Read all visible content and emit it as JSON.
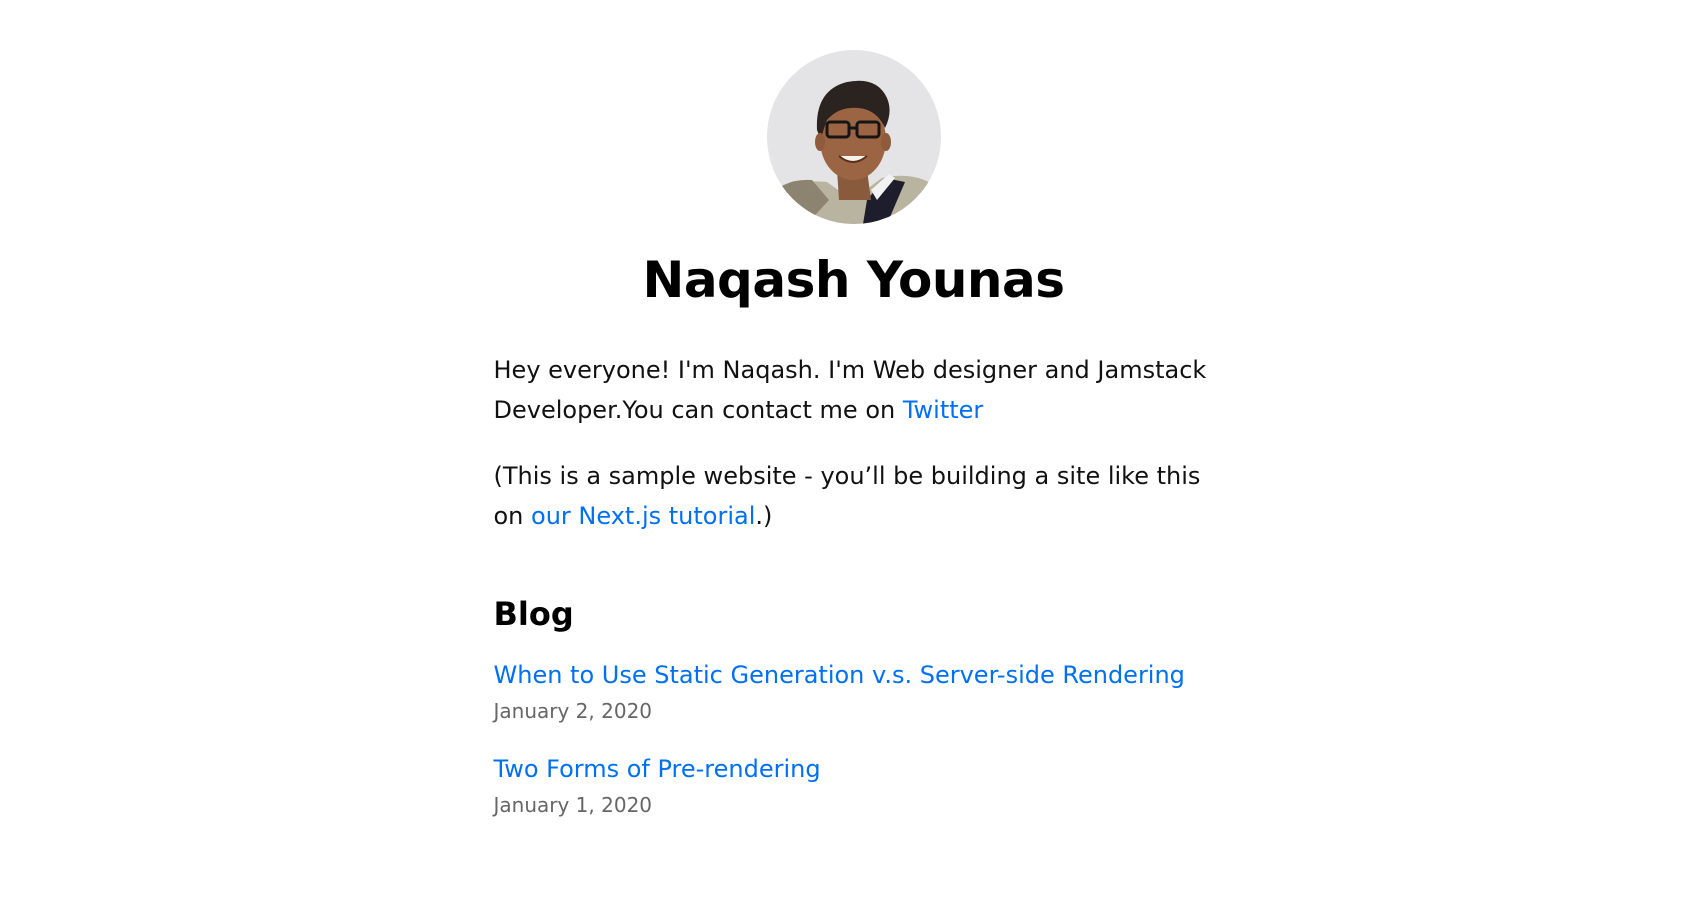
{
  "profile": {
    "name": "Naqash Younas",
    "avatar_icon": "profile-photo"
  },
  "intro": {
    "line1_text": "Hey everyone! I'm Naqash. I'm Web designer and Jamstack Developer.You can contact me on ",
    "twitter_link": "Twitter",
    "line2_prefix": "(This is a sample website - you’ll be building a site like this on ",
    "tutorial_link": "our Next.js tutorial",
    "line2_suffix": ".)"
  },
  "blog": {
    "heading": "Blog",
    "posts": [
      {
        "title": "When to Use Static Generation v.s. Server-side Rendering",
        "date": "January 2, 2020"
      },
      {
        "title": "Two Forms of Pre-rendering",
        "date": "January 1, 2020"
      }
    ]
  },
  "colors": {
    "link": "#0070f3",
    "date": "#666666",
    "text": "#111111"
  }
}
